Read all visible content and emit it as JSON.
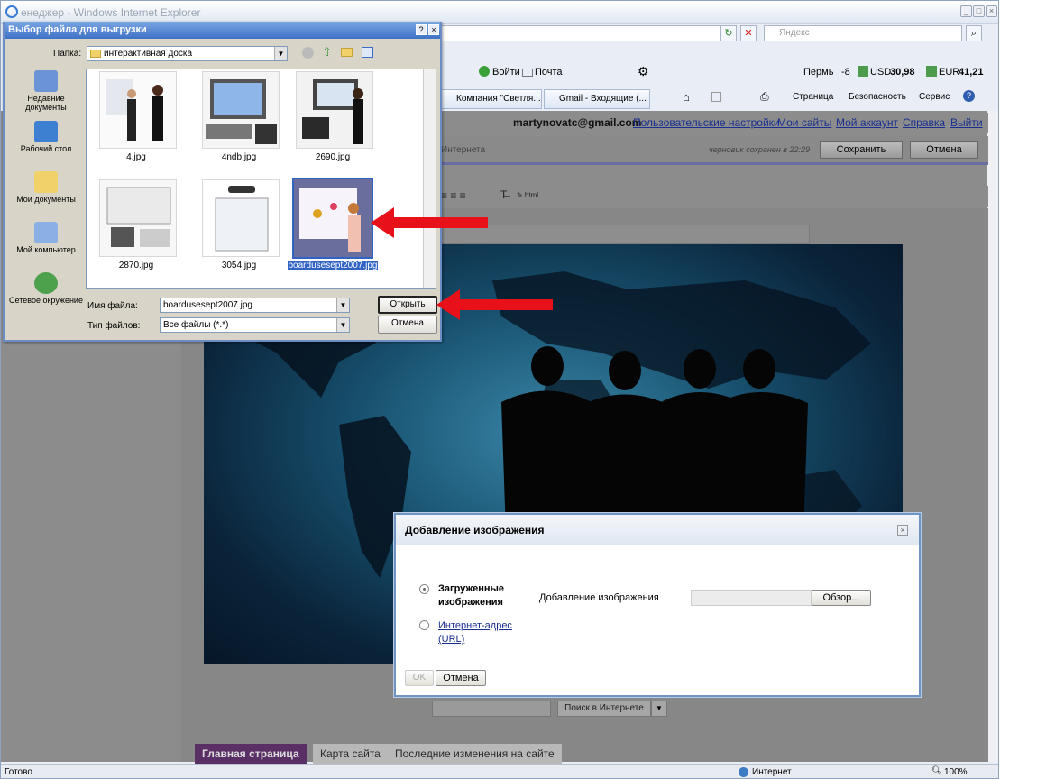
{
  "browser": {
    "title": "енеджер - Windows Internet Explorer",
    "search_placeholder": "Яндекс",
    "toolbar": {
      "login": "Войти",
      "mail": "Почта",
      "city_weather": "Пермь",
      "temperature": "-8",
      "usd_label": "USD",
      "usd_value": "30,98",
      "eur_label": "EUR",
      "eur_value": "41,21"
    },
    "tabs": [
      {
        "label": "Компания \"Светля..."
      },
      {
        "label": "Gmail - Входящие (..."
      }
    ],
    "command_bar": {
      "page": "Страница",
      "security": "Безопасность",
      "service": "Сервис"
    }
  },
  "site": {
    "user_email": "martynovatc@gmail.com",
    "user_links": [
      "Пользовательские настройки",
      "Мои сайты",
      "Мой аккаунт",
      "Справка",
      "Выйти"
    ],
    "editor_label": "Интернета",
    "draft_saved": "черновик сохранен в 22:29",
    "save_button": "Сохранить",
    "cancel_button": "Отмена",
    "search_web_button": "Поиск в Интернете",
    "nav_tabs": [
      "Главная страница",
      "Карта сайта",
      "Последние изменения на сайте"
    ]
  },
  "status_bar": {
    "status": "Готово",
    "zone": "Интернет",
    "zoom": "100%"
  },
  "file_dialog": {
    "title": "Выбор файла для выгрузки",
    "folder_label": "Папка:",
    "folder_value": "интерактивная доска",
    "places": [
      "Недавние документы",
      "Рабочий стол",
      "Мои документы",
      "Мой компьютер",
      "Сетевое окружение"
    ],
    "files": [
      "4.jpg",
      "4ndb.jpg",
      "2690.jpg",
      "2870.jpg",
      "3054.jpg",
      "boardusesept2007.jpg"
    ],
    "filename_label": "Имя файла:",
    "filename_value": "boardusesept2007.jpg",
    "filetype_label": "Тип файлов:",
    "filetype_value": "Все файлы (*.*)",
    "open_button": "Открыть",
    "cancel_button": "Отмена"
  },
  "upload_dialog": {
    "title": "Добавление изображения",
    "option_uploaded": "Загруженные изображения",
    "option_url": "Интернет-адрес (URL)",
    "field_label": "Добавление изображения",
    "browse_button": "Обзор...",
    "ok_button": "OK",
    "cancel_button": "Отмена"
  },
  "colors": {
    "accent_red": "#e8111a",
    "dialog_title_blue": "#3f72c6",
    "selection_blue": "#3163c5",
    "link_blue": "#1a2f8f"
  }
}
